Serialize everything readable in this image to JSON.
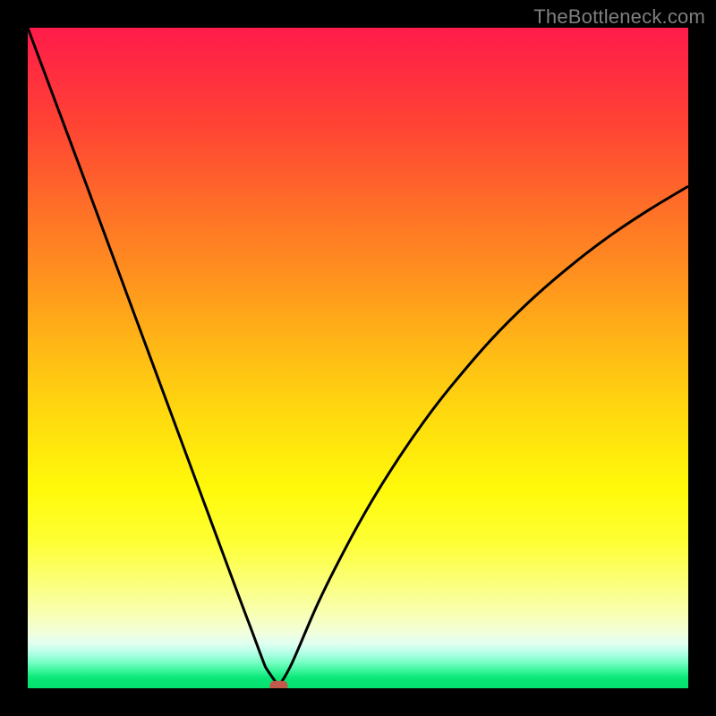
{
  "watermark": "TheBottleneck.com",
  "colors": {
    "frame": "#000000",
    "curve": "#000000",
    "marker": "#c15a4a"
  },
  "chart_data": {
    "type": "line",
    "title": "",
    "xlabel": "",
    "ylabel": "",
    "xlim": [
      0,
      100
    ],
    "ylim": [
      0,
      100
    ],
    "grid": false,
    "legend": false,
    "series": [
      {
        "name": "bottleneck-curve",
        "x": [
          0,
          4,
          8,
          12,
          16,
          20,
          24,
          28,
          32,
          34,
          36,
          38,
          40,
          44,
          48,
          52,
          56,
          60,
          64,
          70,
          76,
          82,
          88,
          94,
          100
        ],
        "y": [
          100,
          89.3,
          78.6,
          67.8,
          57.0,
          46.2,
          35.4,
          24.6,
          13.8,
          8.5,
          3.2,
          0.3,
          3.8,
          13.0,
          21.0,
          28.2,
          34.6,
          40.4,
          45.6,
          52.6,
          58.6,
          63.8,
          68.4,
          72.4,
          76.0
        ]
      }
    ],
    "marker": {
      "name": "optimal-point",
      "x": 38,
      "y": 0.3
    }
  }
}
